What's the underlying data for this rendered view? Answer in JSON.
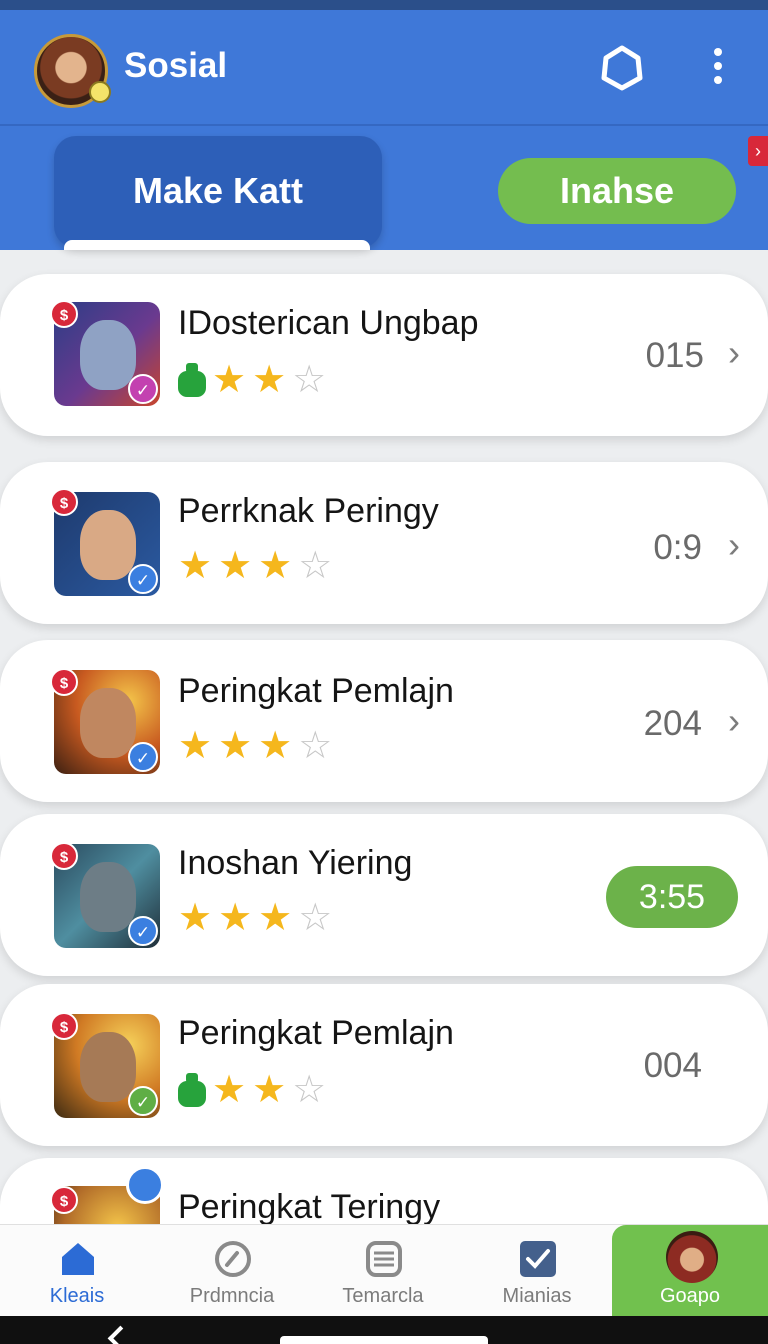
{
  "app": {
    "title": "Sosial",
    "accent": "#3f78d8",
    "green": "#71c14e"
  },
  "tabs": {
    "make": "Make Katt",
    "inahse": "Inahse",
    "edge_glyph": "›"
  },
  "list": {
    "items": [
      {
        "name": "IDosterican Ungbap",
        "score": "015",
        "stars_on": 2,
        "stars_total": 3,
        "potion": true,
        "chevron": "›"
      },
      {
        "name": "Perrknak Peringy",
        "score": "0:9",
        "stars_on": 3,
        "stars_total": 4,
        "potion": false,
        "chevron": "›"
      },
      {
        "name": "Peringkat Pemlajn",
        "score": "204",
        "stars_on": 3,
        "stars_total": 4,
        "potion": false,
        "chevron": "›"
      },
      {
        "name": "Inoshan Yiering",
        "score": "3:55",
        "stars_on": 3,
        "stars_total": 4,
        "potion": false,
        "highlighted": true
      },
      {
        "name": "Peringkat Pemlajn",
        "score": "004",
        "stars_on": 2,
        "stars_total": 3,
        "potion": true
      },
      {
        "name": "Peringkat Teringy",
        "score": "",
        "stars_on": 0,
        "stars_total": 0,
        "potion": false
      }
    ],
    "tag_glyph": "$",
    "check_glyph": "✓",
    "star_glyph": "★"
  },
  "nav": {
    "items": [
      {
        "label": "Kleais",
        "icon": "home-icon",
        "active": true
      },
      {
        "label": "Prdmncia",
        "icon": "compass-icon",
        "active": false
      },
      {
        "label": "Temarcla",
        "icon": "stack-icon",
        "active": false
      },
      {
        "label": "Mianias",
        "icon": "checkbox-icon",
        "active": false
      },
      {
        "label": "Goapo",
        "icon": "avatar-icon",
        "active": false
      }
    ]
  }
}
